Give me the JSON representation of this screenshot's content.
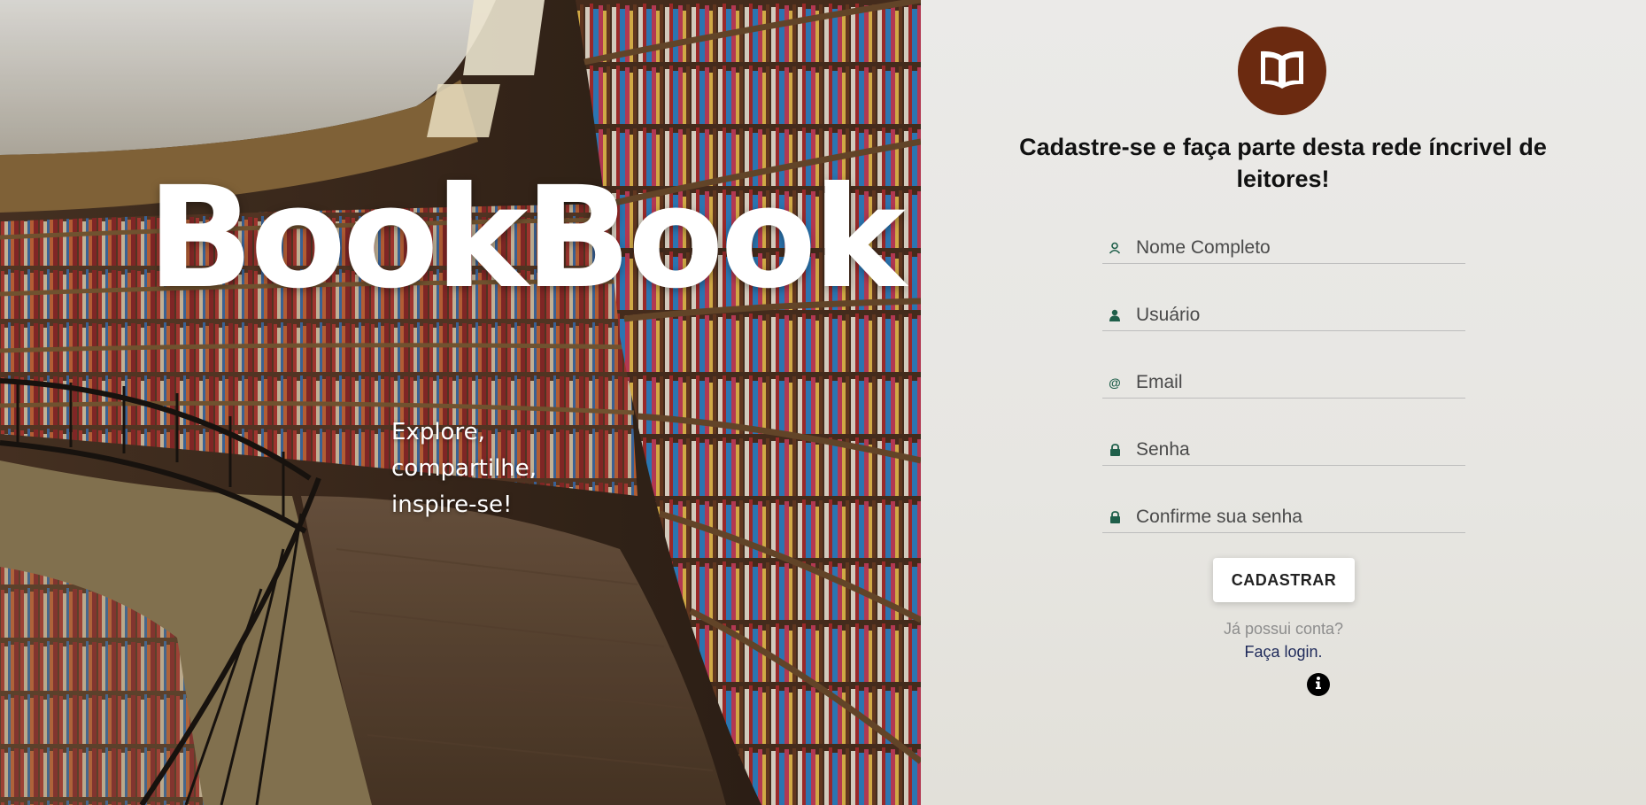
{
  "hero": {
    "brand": "BookBook",
    "tagline": [
      "Explore,",
      "compartilhe,",
      "inspire-se!"
    ]
  },
  "panel": {
    "logo_icon": "open-book-icon",
    "headline": "Cadastre-se e faça parte desta rede íncrivel de leitores!",
    "fields": [
      {
        "icon": "user-outline-icon",
        "placeholder": "Nome Completo",
        "value": ""
      },
      {
        "icon": "user-icon",
        "placeholder": "Usuário",
        "value": ""
      },
      {
        "icon": "at-icon",
        "placeholder": "Email",
        "value": ""
      },
      {
        "icon": "lock-icon",
        "placeholder": "Senha",
        "value": ""
      },
      {
        "icon": "lock-icon",
        "placeholder": "Confirme sua senha",
        "value": ""
      }
    ],
    "submit_label": "CADASTRAR",
    "already_text": "Já possui conta?",
    "login_link": "Faça login.",
    "info_icon": "info-icon"
  },
  "colors": {
    "logo_bg": "#6b2a10",
    "icon_accent": "#1f5f4a",
    "link": "#1e2a5a",
    "panel_bg": "#ebeae8"
  }
}
